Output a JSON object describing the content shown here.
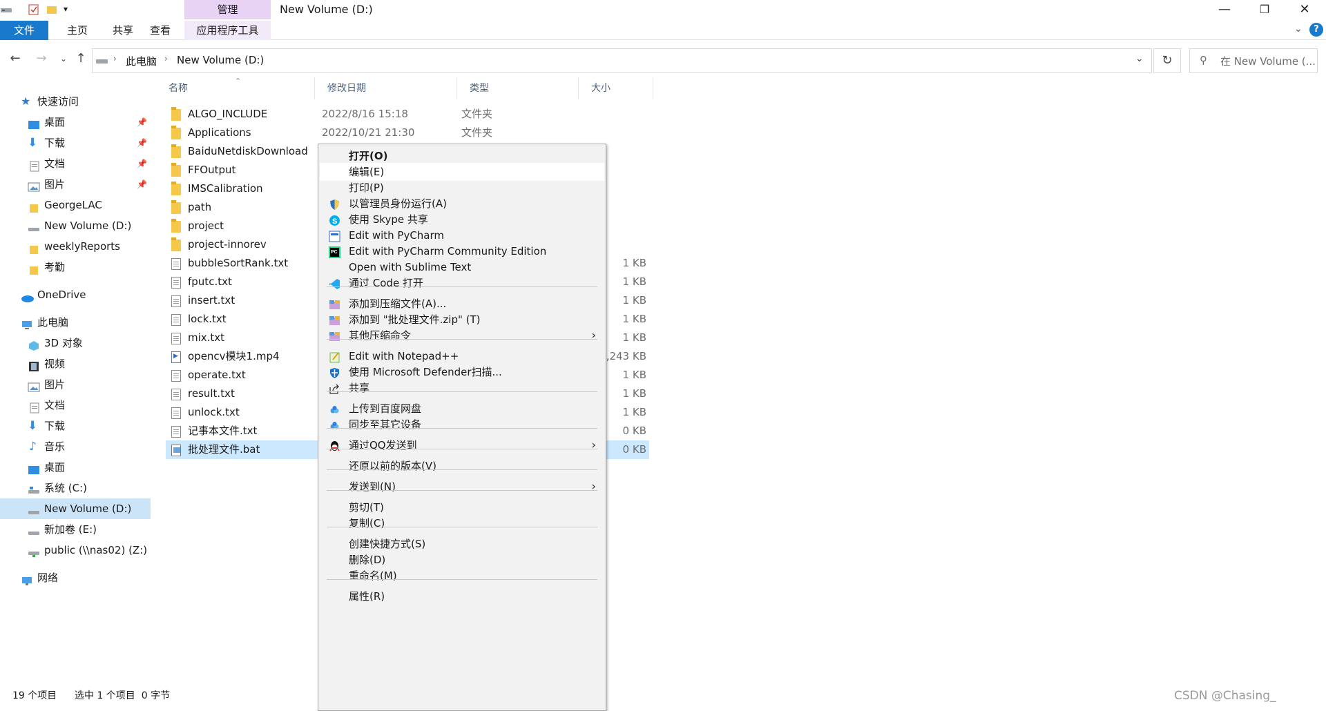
{
  "titlebar": {
    "window_title": "New Volume (D:)",
    "manage_tab": "管理",
    "controls": {
      "minimize": "—",
      "maximize": "❐",
      "close": "✕"
    }
  },
  "ribbon": {
    "tabs": [
      {
        "label": "文件"
      },
      {
        "label": "主页"
      },
      {
        "label": "共享"
      },
      {
        "label": "查看"
      },
      {
        "label": "应用程序工具"
      }
    ],
    "help": "?"
  },
  "address": {
    "crumbs": [
      "此电脑",
      "New Volume (D:)"
    ],
    "search_placeholder": "在 New Volume (..."
  },
  "navpane": {
    "quick_access": "快速访问",
    "quick_items": [
      "桌面",
      "下载",
      "文档",
      "图片",
      "GeorgeLAC",
      "New Volume (D:)",
      "weeklyReports",
      "考勤"
    ],
    "onedrive": "OneDrive",
    "this_pc": "此电脑",
    "pc_items": [
      "3D 对象",
      "视频",
      "图片",
      "文档",
      "下载",
      "音乐",
      "桌面",
      "系统 (C:)",
      "New Volume (D:)",
      "新加卷 (E:)",
      "public (\\\\nas02) (Z:)"
    ],
    "network": "网络"
  },
  "columns": {
    "name": "名称",
    "date": "修改日期",
    "type": "类型",
    "size": "大小"
  },
  "files": [
    {
      "name": "ALGO_INCLUDE",
      "date": "2022/8/16 15:18",
      "type": "文件夹",
      "size": "",
      "kind": "folder"
    },
    {
      "name": "Applications",
      "date": "2022/10/21 21:30",
      "type": "文件夹",
      "size": "",
      "kind": "folder"
    },
    {
      "name": "BaiduNetdiskDownload",
      "date": "",
      "type": "",
      "size": "",
      "kind": "folder"
    },
    {
      "name": "FFOutput",
      "date": "",
      "type": "",
      "size": "",
      "kind": "folder"
    },
    {
      "name": "IMSCalibration",
      "date": "",
      "type": "",
      "size": "",
      "kind": "folder"
    },
    {
      "name": "path",
      "date": "",
      "type": "",
      "size": "",
      "kind": "folder"
    },
    {
      "name": "project",
      "date": "",
      "type": "",
      "size": "",
      "kind": "folder"
    },
    {
      "name": "project-innorev",
      "date": "",
      "type": "",
      "size": "",
      "kind": "folder"
    },
    {
      "name": "bubbleSortRank.txt",
      "date": "",
      "type": "",
      "size": "1 KB",
      "kind": "txt"
    },
    {
      "name": "fputc.txt",
      "date": "",
      "type": "",
      "size": "1 KB",
      "kind": "txt"
    },
    {
      "name": "insert.txt",
      "date": "",
      "type": "",
      "size": "1 KB",
      "kind": "txt"
    },
    {
      "name": "lock.txt",
      "date": "",
      "type": "",
      "size": "1 KB",
      "kind": "txt"
    },
    {
      "name": "mix.txt",
      "date": "",
      "type": "",
      "size": "1 KB",
      "kind": "txt"
    },
    {
      "name": "opencv模块1.mp4",
      "date": "",
      "type": "",
      "size": ",243 KB",
      "kind": "mp4"
    },
    {
      "name": "operate.txt",
      "date": "",
      "type": "",
      "size": "1 KB",
      "kind": "txt"
    },
    {
      "name": "result.txt",
      "date": "",
      "type": "",
      "size": "1 KB",
      "kind": "txt"
    },
    {
      "name": "unlock.txt",
      "date": "",
      "type": "",
      "size": "1 KB",
      "kind": "txt"
    },
    {
      "name": "记事本文件.txt",
      "date": "",
      "type": "",
      "size": "0 KB",
      "kind": "txt"
    },
    {
      "name": "批处理文件.bat",
      "date": "",
      "type": "",
      "size": "0 KB",
      "kind": "bat",
      "selected": true
    }
  ],
  "context_menu": {
    "items": [
      {
        "label": "打开(O)",
        "bold": true
      },
      {
        "label": "编辑(E)",
        "highlighted": true
      },
      {
        "label": "打印(P)"
      },
      {
        "label": "以管理员身份运行(A)",
        "icon": "shield-icon"
      },
      {
        "label": "使用 Skype 共享",
        "icon": "skype-icon"
      },
      {
        "label": "Edit with PyCharm",
        "icon": "pycharm-icon"
      },
      {
        "label": "Edit with PyCharm Community Edition",
        "icon": "pycharm-ce-icon"
      },
      {
        "label": "Open with Sublime Text"
      },
      {
        "label": "通过 Code 打开",
        "icon": "vscode-icon"
      },
      {
        "label": "添加到压缩文件(A)...",
        "icon": "winrar-icon"
      },
      {
        "label": "添加到 \"批处理文件.zip\" (T)",
        "icon": "winrar-icon"
      },
      {
        "label": "其他压缩命令",
        "icon": "winrar-icon",
        "submenu": true
      },
      {
        "label": "Edit with Notepad++",
        "icon": "notepadpp-icon"
      },
      {
        "label": "使用 Microsoft Defender扫描...",
        "icon": "defender-icon"
      },
      {
        "label": "共享",
        "icon": "share-icon"
      },
      {
        "label": "上传到百度网盘",
        "icon": "baidu-cloud-icon"
      },
      {
        "label": "同步至其它设备",
        "icon": "baidu-sync-icon"
      },
      {
        "label": "通过QQ发送到",
        "icon": "qq-icon",
        "submenu": true
      },
      {
        "label": "还原以前的版本(V)"
      },
      {
        "label": "发送到(N)",
        "submenu": true
      },
      {
        "label": "剪切(T)"
      },
      {
        "label": "复制(C)"
      },
      {
        "label": "创建快捷方式(S)"
      },
      {
        "label": "删除(D)"
      },
      {
        "label": "重命名(M)"
      },
      {
        "label": "属性(R)"
      }
    ]
  },
  "status": {
    "count": "19 个项目",
    "selection": "选中 1 个项目  0 字节"
  },
  "watermark": "CSDN @Chasing_"
}
